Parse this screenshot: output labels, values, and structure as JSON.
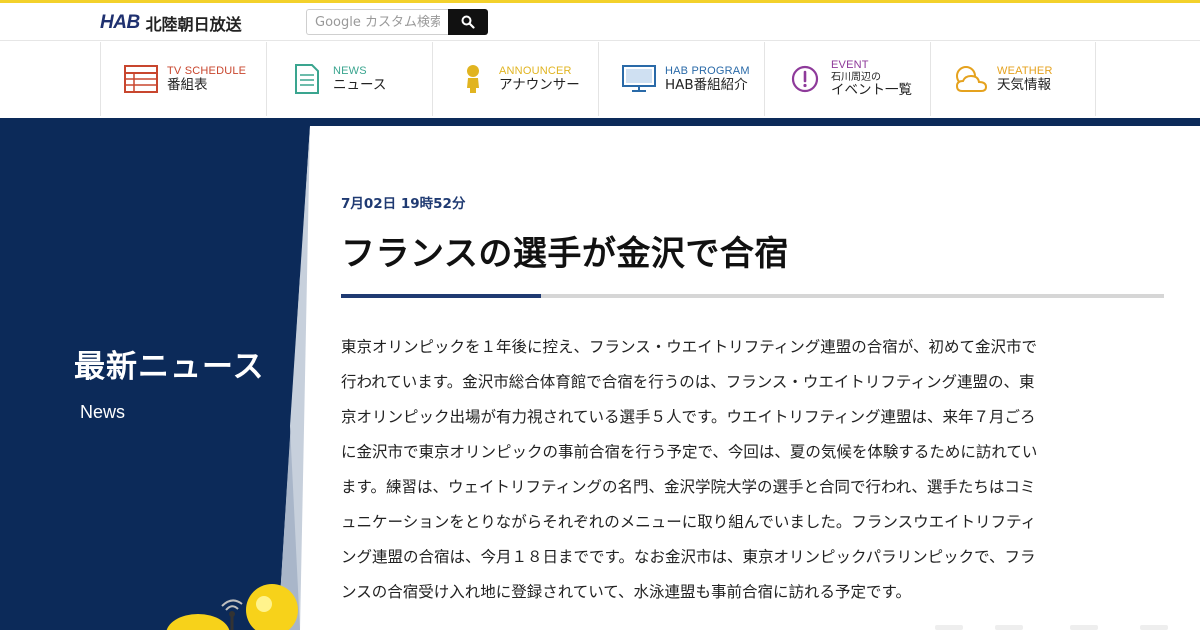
{
  "header": {
    "logo_mark": "HAB",
    "logo_name": "北陸朝日放送",
    "search_placeholder": "Google カスタム検索"
  },
  "nav": [
    {
      "en": "TV SCHEDULE",
      "ja": "番組表",
      "sub": "",
      "color": "#c8462e",
      "icon": "tv-schedule-icon"
    },
    {
      "en": "NEWS",
      "ja": "ニュース",
      "sub": "",
      "color": "#3aa58f",
      "icon": "news-icon"
    },
    {
      "en": "ANNOUNCER",
      "ja": "アナウンサー",
      "sub": "",
      "color": "#e1b420",
      "icon": "announcer-icon"
    },
    {
      "en": "HAB PROGRAM",
      "ja": "HAB番組紹介",
      "sub": "",
      "color": "#2a6aa8",
      "icon": "monitor-icon"
    },
    {
      "en": "EVENT",
      "ja": "イベント一覧",
      "sub": "石川周辺の",
      "color": "#8e3a9a",
      "icon": "event-icon"
    },
    {
      "en": "WEATHER",
      "ja": "天気情報",
      "sub": "",
      "color": "#e5a21e",
      "icon": "weather-icon"
    }
  ],
  "section": {
    "title": "最新ニュース",
    "subtitle": "News"
  },
  "article": {
    "date": "7月02日 19時52分",
    "headline": "フランスの選手が金沢で合宿",
    "body_lines": [
      "東京オリンピックを１年後に控え、フランス・ウエイトリフティング連盟の合宿が、初めて金沢市で",
      "行われています。金沢市総合体育館で合宿を行うのは、フランス・ウエイトリフティング連盟の、東",
      "京オリンピック出場が有力視されている選手５人です。ウエイトリフティング連盟は、来年７月ごろ",
      "に金沢市で東京オリンピックの事前合宿を行う予定で、今回は、夏の気候を体験するために訪れてい",
      "ます。練習は、ウェイトリフティングの名門、金沢学院大学の選手と合同で行われ、選手たちはコミ",
      "ュニケーションをとりながらそれぞれのメニューに取り組んでいました。フランスウエイトリフティ",
      "ング連盟の合宿は、今月１８日までです。なお金沢市は、東京オリンピックパラリンピックで、フラ",
      "ンスの合宿受け入れ地に登録されていて、水泳連盟も事前合宿に訪れる予定です。"
    ]
  },
  "colors": {
    "navy": "#0c2a59",
    "accent_yellow": "#f3d12b",
    "headline_rule": "#1f3a72"
  }
}
